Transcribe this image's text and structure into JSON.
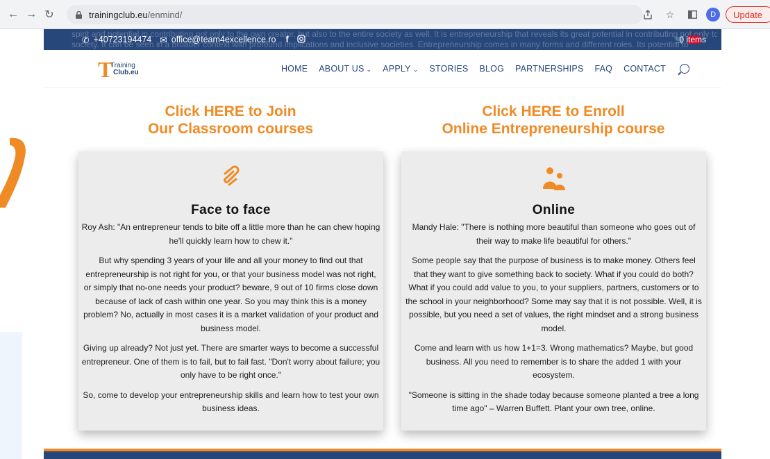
{
  "browser": {
    "url_host": "trainingclub.eu",
    "url_path": "/enmind/",
    "profile_initial": "D",
    "update_label": "Update"
  },
  "topbar": {
    "phone": "+40723194474",
    "email": "office@team4excellence.ro",
    "faded_line1": "spirit and potential in contributing not only to the own creator, but also to the entire society as well. It is entrepreneurship that reveals its great potential in contributing not only to the creator.",
    "faded_line2": "society. It can be seen in a broader context with profound implications and inclusive societies. Entrepreneurship comes in many forms and different roles. Its potential to",
    "cart_items": "0 items"
  },
  "logo": {
    "line1": "Training",
    "line2": "Club.eu"
  },
  "menu": {
    "home": "HOME",
    "about": "ABOUT US",
    "apply": "APPLY",
    "stories": "STORIES",
    "blog": "BLOG",
    "partnerships": "PARTNERSHIPS",
    "faq": "FAQ",
    "contact": "CONTACT"
  },
  "left": {
    "headline_line1": "Click HERE to Join",
    "headline_line2": "Our Classroom courses",
    "card_title": "Face to face",
    "paragraphs": [
      "Roy Ash: \"An entrepreneur tends to bite off a little more than he can chew hoping he'll quickly learn how to chew it.\"",
      "But why spending 3 years of your life and all your money to find out that entrepreneurship is not right for you, or that your business model was not right, or simply that no-one needs your product? beware, 9 out of 10 firms close down because of lack of cash within one year. So you may think this is a money problem? No, actually in most cases it is a market validation of your product and business model.",
      "Giving up already? Not just yet. There are smarter ways to become a successful entrepreneur. One of them is to fail, but to fail fast. \"Don't worry about failure; you only have to be right once.\"",
      "So, come to develop your entrepreneurship skills and learn how to test your own business ideas."
    ]
  },
  "right": {
    "headline_line1": "Click HERE to Enroll",
    "headline_line2": "Online Entrepreneurship course",
    "card_title": "Online",
    "paragraphs": [
      "Mandy Hale: \"There is nothing more beautiful than someone who goes out of their way to make life beautiful for others.\"",
      "Some people say that the purpose of business is to make money. Others feel that they want to give something back to society. What if you could do both? What if you could add value to you, to your suppliers, partners, customers or to the school in your neighborhood? Some may say that it is not possible. Well, it is possible, but you need a set of values, the right mindset and a strong business model.",
      "Come and learn with us how 1+1=3. Wrong mathematics? Maybe, but good business. All you need to remember is to share the added 1 with your ecosystem.",
      "\"Someone is sitting in the shade today because someone planted a tree a long time ago\" – Warren Buffett. Plant your own tree, online."
    ]
  },
  "colors": {
    "orange": "#f08a24",
    "navy": "#27467a"
  }
}
